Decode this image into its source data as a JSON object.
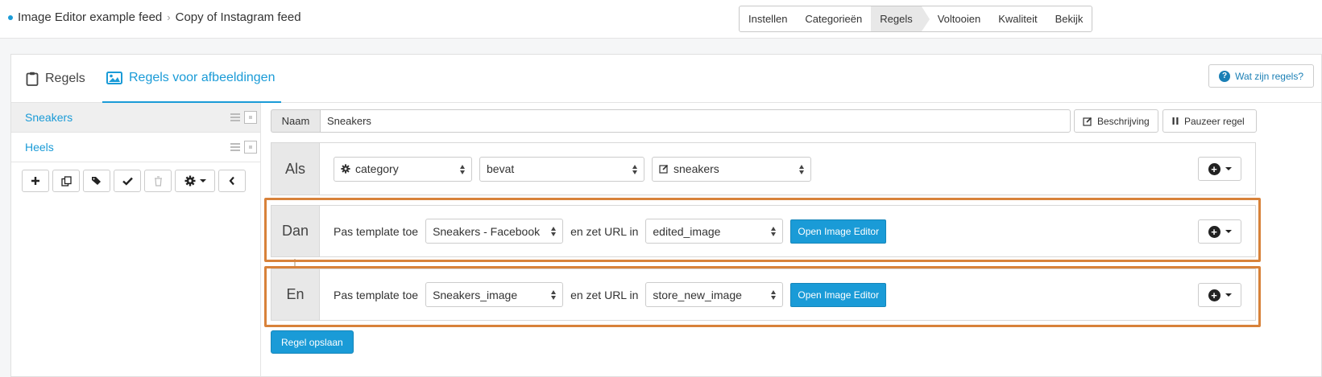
{
  "breadcrumb": {
    "parent": "Image Editor example feed",
    "current": "Copy of Instagram feed"
  },
  "steps": [
    "Instellen",
    "Categorieën",
    "Regels",
    "Voltooien",
    "Kwaliteit",
    "Bekijk"
  ],
  "steps_active": "Regels",
  "tabs": {
    "regels": "Regels",
    "afbeeldingen": "Regels voor afbeeldingen"
  },
  "help_button": "Wat zijn regels?",
  "rules": [
    {
      "name": "Sneakers",
      "active": true
    },
    {
      "name": "Heels",
      "active": false
    }
  ],
  "sidebar_toolbar_icons": [
    "plus-icon",
    "copy-icon",
    "tag-icon",
    "check-icon",
    "trash-icon",
    "gear-dropdown-icon",
    "chevron-left-icon"
  ],
  "form": {
    "name_label": "Naam",
    "name_value": "Sneakers",
    "beschrijving_button": "Beschrijving",
    "pauzeer_button": "Pauzeer regel",
    "als": {
      "label": "Als",
      "field": "category",
      "operator": "bevat",
      "value": "sneakers"
    },
    "dan": {
      "label": "Dan",
      "pas_text": "Pas template toe",
      "template": "Sneakers - Facebook",
      "url_text": "en zet URL in",
      "url_field": "edited_image",
      "open_button": "Open Image Editor"
    },
    "en": {
      "label": "En",
      "pas_text": "Pas template toe",
      "template": "Sneakers_image",
      "url_text": "en zet URL in",
      "url_field": "store_new_image",
      "open_button": "Open Image Editor"
    },
    "save_button": "Regel opslaan"
  },
  "colors": {
    "accent": "#1a9bd7",
    "highlight": "#d8823a"
  }
}
